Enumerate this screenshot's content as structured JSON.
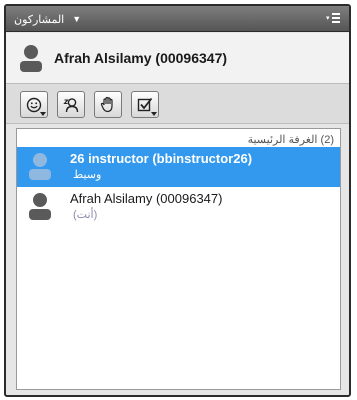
{
  "panel": {
    "title": "المشاركون",
    "title_caret_icon": "caret-down-icon",
    "menu_icon": "panel-menu-icon"
  },
  "current_user": {
    "name": "Afrah Alsilamy (00096347)",
    "avatar_icon": "person-icon"
  },
  "toolbar": {
    "buttons": [
      {
        "name": "emoticon-button",
        "icon": "smiley-icon",
        "has_dropdown": true
      },
      {
        "name": "away-status-button",
        "icon": "person-away-icon",
        "has_dropdown": false
      },
      {
        "name": "raise-hand-button",
        "icon": "hand-icon",
        "has_dropdown": false
      },
      {
        "name": "poll-response-button",
        "icon": "checkbox-icon",
        "has_dropdown": true
      }
    ]
  },
  "room": {
    "header": "(2) الغرفة الرئيسية",
    "participants": [
      {
        "name": "26 instructor (bbinstructor26)",
        "role": "وسيط",
        "selected": true
      },
      {
        "name": "Afrah Alsilamy (00096347)",
        "role": "(أنت)",
        "selected": false
      }
    ]
  },
  "colors": {
    "title_bar": "#555555",
    "selection": "#3399ee",
    "panel_bg": "#e6e6e6"
  }
}
